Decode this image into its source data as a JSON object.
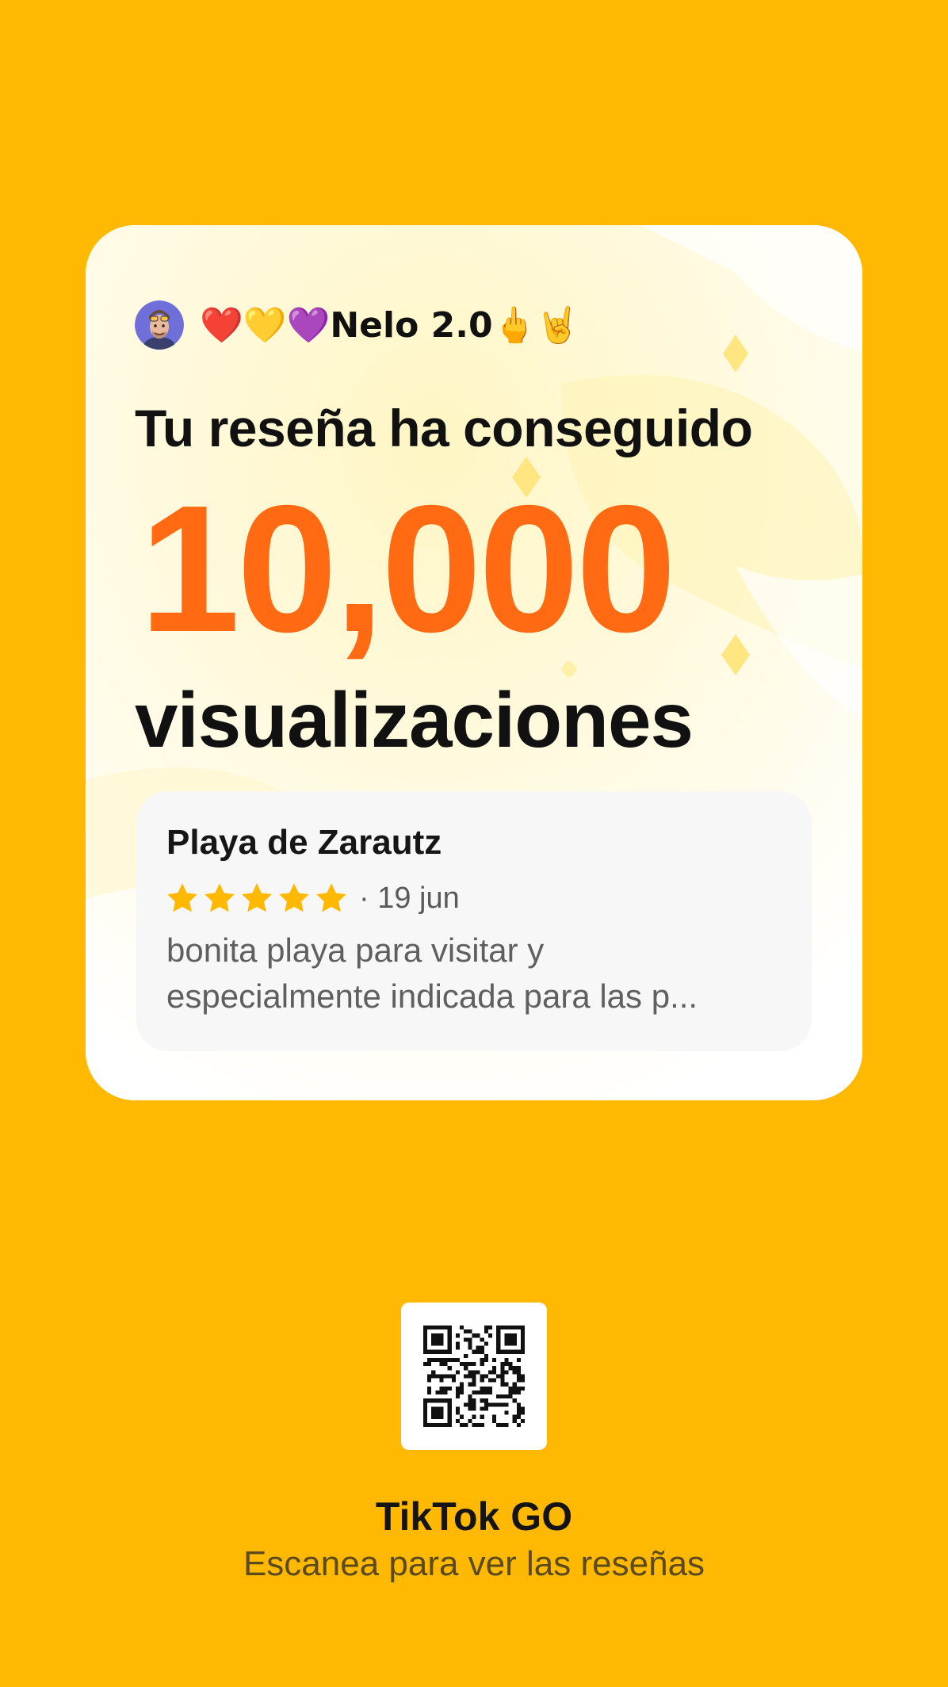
{
  "colors": {
    "background": "#FFB902",
    "accent": "#FF6A13",
    "star": "#FFB902"
  },
  "card": {
    "username": "❤️💛💜Nelo 2.0🖕🤘",
    "headline": "Tu reseña ha conseguido",
    "view_count": "10,000",
    "views_label": "visualizaciones"
  },
  "review": {
    "place": "Playa de Zarautz",
    "rating": 5,
    "date": "· 19 jun",
    "text_line1": "bonita playa para visitar y",
    "text_line2": "especialmente indicada para las p..."
  },
  "footer": {
    "brand": "TikTok GO",
    "scan_label": "Escanea para ver las reseñas"
  },
  "icons": {
    "avatar": "user-avatar",
    "star": "star-icon",
    "qr": "qr-code"
  }
}
